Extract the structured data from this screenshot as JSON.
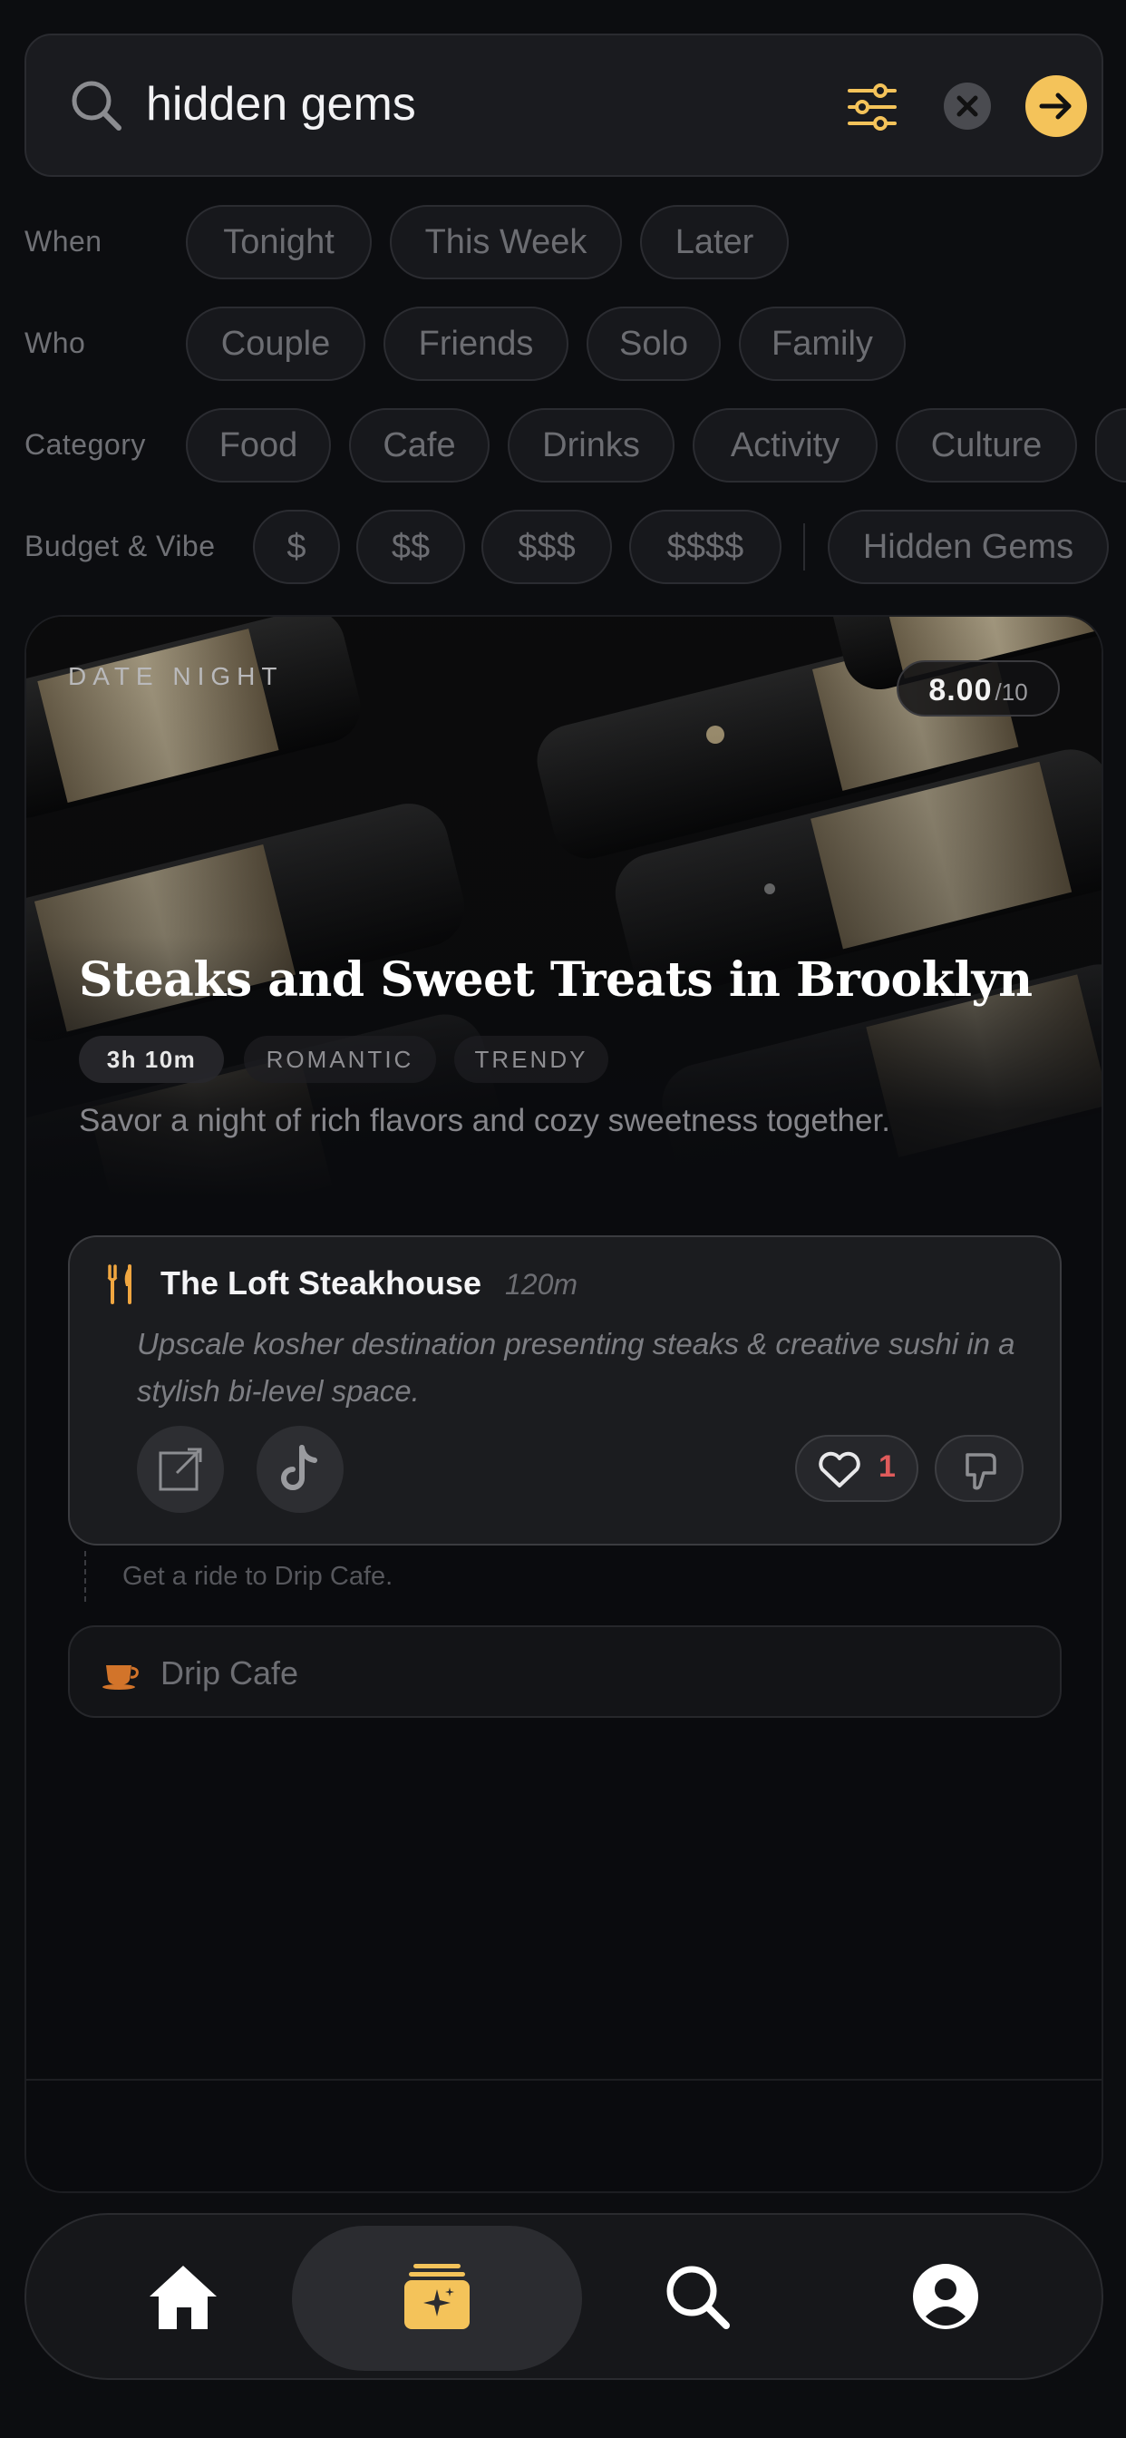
{
  "search": {
    "query": "hidden gems",
    "icons": [
      "search-icon",
      "sliders-icon",
      "clear-icon",
      "arrow-right-icon"
    ]
  },
  "filters": {
    "when": {
      "label": "When",
      "options": [
        "Tonight",
        "This Week",
        "Later"
      ]
    },
    "who": {
      "label": "Who",
      "options": [
        "Couple",
        "Friends",
        "Solo",
        "Family"
      ]
    },
    "category": {
      "label": "Category",
      "options": [
        "Food",
        "Cafe",
        "Drinks",
        "Activity",
        "Culture"
      ]
    },
    "budget": {
      "label": "Budget & Vibe",
      "options": [
        "$",
        "$$",
        "$$$",
        "$$$$"
      ],
      "vibe": [
        "Hidden Gems"
      ]
    }
  },
  "plan": {
    "eyebrow": "DATE NIGHT",
    "score": "8.00",
    "score_denominator": "/10",
    "title": "Steaks and Sweet Treats in Brooklyn",
    "duration": "3h 10m",
    "tags": [
      "ROMANTIC",
      "TRENDY"
    ],
    "subtitle": "Savor a night of rich flavors and cozy sweetness together.",
    "stops": [
      {
        "name": "The Loft Steakhouse",
        "minutes": "120m",
        "description": "Upscale kosher destination presenting steaks & creative sushi in a stylish bi-level space.",
        "likes": "1",
        "icon": "fork-knife-icon"
      },
      {
        "name": "Drip Cafe",
        "icon": "coffee-cup-icon"
      }
    ],
    "connector": "Get a ride to Drip Cafe."
  },
  "nav": {
    "items": [
      "home-icon",
      "plans-icon",
      "search-icon",
      "profile-icon"
    ],
    "active": 1
  },
  "colors": {
    "accent": "#f4c35a",
    "like": "#e05b5b",
    "background": "#0c0d10"
  }
}
